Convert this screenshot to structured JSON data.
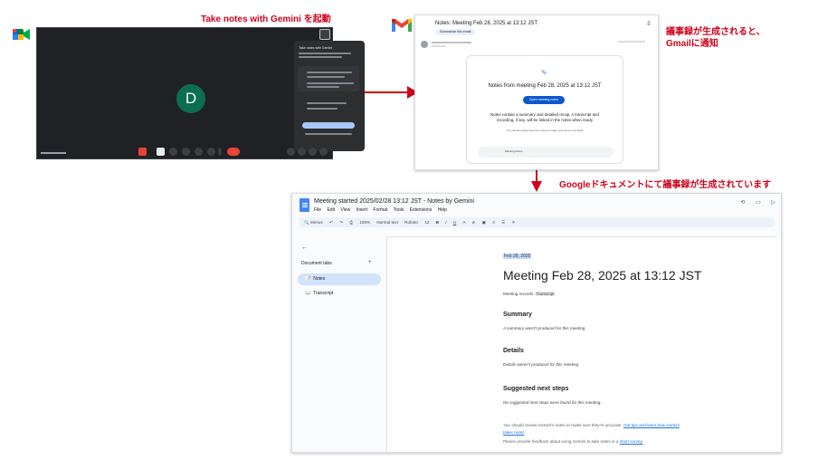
{
  "annotations": {
    "meet_label": "Take notes with Gemini を起動",
    "gmail_label_line1": "議事録が生成されると、",
    "gmail_label_line2": "Gmailに通知",
    "docs_label": "Googleドキュメントにて議事録が生成されています"
  },
  "colors": {
    "annotation_red": "#d0021b",
    "meet_bg": "#202124",
    "avatar_green": "#0b6e4f",
    "docs_blue": "#4285f4",
    "button_blue": "#0b57d0"
  },
  "meet": {
    "avatar_letter": "D",
    "icons": [
      "meet-logo-icon",
      "gemini-pen-icon",
      "mic-icon",
      "camera-icon",
      "hand-icon",
      "end-call-icon",
      "info-icon",
      "people-icon",
      "chat-icon"
    ],
    "panel": {
      "title": "Take notes with Gemini"
    }
  },
  "gmail": {
    "subject": "Notes: Meeting Feb 28, 2025 at 13:12 JST",
    "summary_chip": "Summarize this email",
    "card_title": "Notes from meeting Feb 28, 2025 at 13:12 JST",
    "open_button": "Open meeting notes",
    "description_line1": "Notes contain a summary and detailed recap. A transcript and",
    "description_line2": "recording, if any, will be linked in the notes when ready",
    "review_note": "You should review Gemini's notes to make sure they're accurate",
    "meeting_chip": "Meeting Notes"
  },
  "docs": {
    "title": "Meeting started 2025/02/28 13:12 JST - Notes by Gemini",
    "menu": [
      "File",
      "Edit",
      "View",
      "Insert",
      "Format",
      "Tools",
      "Extensions",
      "Help"
    ],
    "toolbar": {
      "search": "Menus",
      "zoom": "100%",
      "style": "Normal text",
      "font": "Roboto",
      "size": "12"
    },
    "side": {
      "tabs_header": "Document tabs",
      "tabs": [
        {
          "icon": "📝",
          "label": "Notes"
        },
        {
          "icon": "📖",
          "label": "Transcript"
        }
      ]
    },
    "page": {
      "date": "Feb 28, 2025",
      "heading": "Meeting Feb 28, 2025 at 13:12 JST",
      "records_label": "Meeting records",
      "records_chip": "Transcript",
      "sections": [
        {
          "title": "Summary",
          "text": "A summary wasn't produced for this meeting."
        },
        {
          "title": "Details",
          "text": "Details weren't produced for this meeting."
        },
        {
          "title": "Suggested next steps",
          "text": "No suggested next steps were found for this meeting."
        }
      ],
      "footer_line1_text": "You should review Gemini's notes to make sure they're accurate.",
      "footer_line1_link": "Get tips and learn how Gemini",
      "footer_line2_link": "takes notes",
      "footer_line3_text": "Please provide feedback about using Gemini to take notes in a",
      "footer_line3_link": "short survey."
    }
  }
}
